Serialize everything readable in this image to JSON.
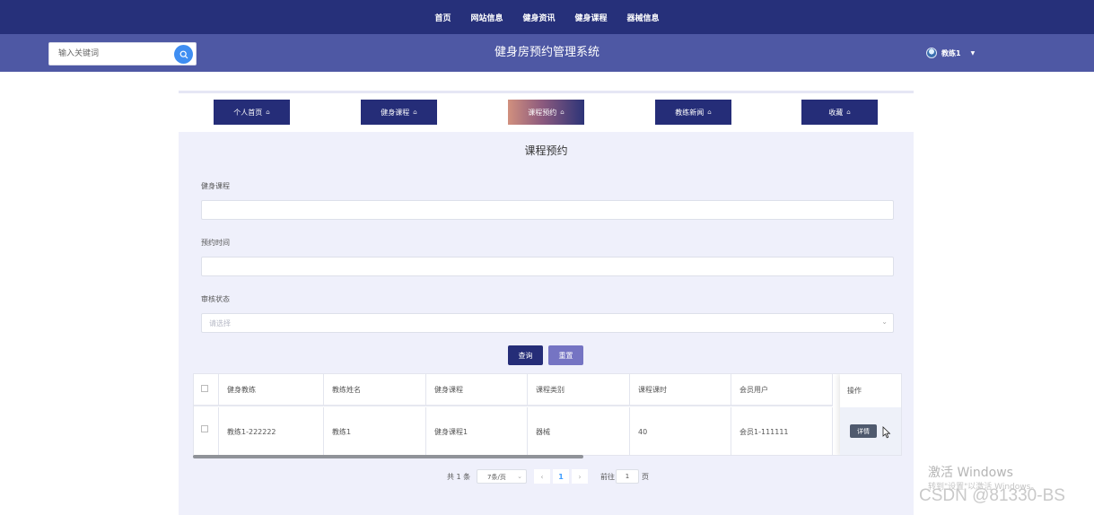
{
  "top_nav": {
    "items": [
      "首页",
      "网站信息",
      "健身资讯",
      "健身课程",
      "器械信息"
    ]
  },
  "header": {
    "search_placeholder": "输入关键词",
    "site_title": "健身房预约管理系统",
    "username": "教练1"
  },
  "tabs": [
    {
      "label": "个人首页",
      "active": false
    },
    {
      "label": "健身课程",
      "active": false
    },
    {
      "label": "课程预约",
      "active": true
    },
    {
      "label": "教练新闻",
      "active": false
    },
    {
      "label": "收藏",
      "active": false
    }
  ],
  "form": {
    "title": "课程预约",
    "course_label": "健身课程",
    "time_label": "预约时间",
    "status_label": "审核状态",
    "status_placeholder": "请选择",
    "query_button": "查询",
    "reset_button": "重置"
  },
  "table": {
    "headers": [
      "健身教练",
      "教练姓名",
      "健身课程",
      "课程类别",
      "课程课时",
      "会员用户",
      "操作"
    ],
    "rows": [
      [
        "教练1-222222",
        "教练1",
        "健身课程1",
        "器械",
        "40",
        "会员1-111111"
      ]
    ],
    "detail_button": "详情"
  },
  "pagination": {
    "total": "共 1 条",
    "page_size": "7条/页",
    "prev": "‹",
    "current_page": "1",
    "next": "›",
    "goto_label": "前往",
    "goto_value": "1",
    "page_suffix": "页"
  },
  "watermark": {
    "activate_title": "激活 Windows",
    "activate_sub": "转到\"设置\"以激活 Windows。",
    "csdn": "CSDN @81330-BS"
  },
  "colors": {
    "nav": "#26307a",
    "subbar": "#4e58a4",
    "panel": "#eff0fb",
    "primary": "#252d78",
    "reset": "#7574c3"
  }
}
